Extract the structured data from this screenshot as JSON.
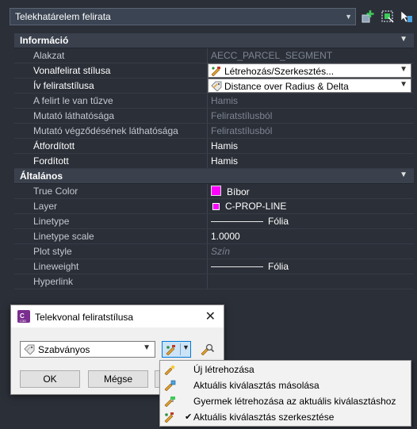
{
  "topbar": {
    "selector_value": "Telekhatárelem felirata"
  },
  "sections": {
    "info_title": "Információ",
    "general_title": "Általános"
  },
  "info_rows": [
    {
      "name": "Alakzat",
      "value": "AECC_PARCEL_SEGMENT"
    },
    {
      "name": "Vonalfelirat stílusa",
      "value": "Létrehozás/Szerkesztés..."
    },
    {
      "name": "Ív feliratstílusa",
      "value": "Distance over Radius & Delta"
    },
    {
      "name": "A felirt le van tűzve",
      "value": "Hamis"
    },
    {
      "name": "Mutató láthatósága",
      "value": "Feliratstílusból"
    },
    {
      "name": "Mutató végződésének láthatósága",
      "value": "Feliratstílusból"
    },
    {
      "name": "Átfordított",
      "value": "Hamis"
    },
    {
      "name": "Fordított",
      "value": "Hamis"
    }
  ],
  "general_rows": [
    {
      "name": "True Color",
      "value": "Bíbor"
    },
    {
      "name": "Layer",
      "value": "C-PROP-LINE"
    },
    {
      "name": "Linetype",
      "value": "Fólia"
    },
    {
      "name": "Linetype scale",
      "value": "1.0000"
    },
    {
      "name": "Plot style",
      "value": "Szín"
    },
    {
      "name": "Lineweight",
      "value": "Fólia"
    },
    {
      "name": "Hyperlink",
      "value": ""
    }
  ],
  "colors": {
    "magenta": "#ff00ff",
    "accent_blue": "#0078d7"
  },
  "dialog": {
    "title": "Telekvonal feliratstílusa",
    "style_value": "Szabványos",
    "ok_label": "OK",
    "cancel_label": "Mégse"
  },
  "menu": {
    "items": [
      {
        "label": "Új létrehozása",
        "icon": "new-style-icon",
        "checked": false
      },
      {
        "label": "Aktuális kiválasztás másolása",
        "icon": "copy-style-icon",
        "checked": false
      },
      {
        "label": "Gyermek létrehozása az aktuális kiválasztáshoz",
        "icon": "child-style-icon",
        "checked": false
      },
      {
        "label": "Aktuális kiválasztás szerkesztése",
        "icon": "edit-style-icon",
        "checked": true
      }
    ]
  }
}
